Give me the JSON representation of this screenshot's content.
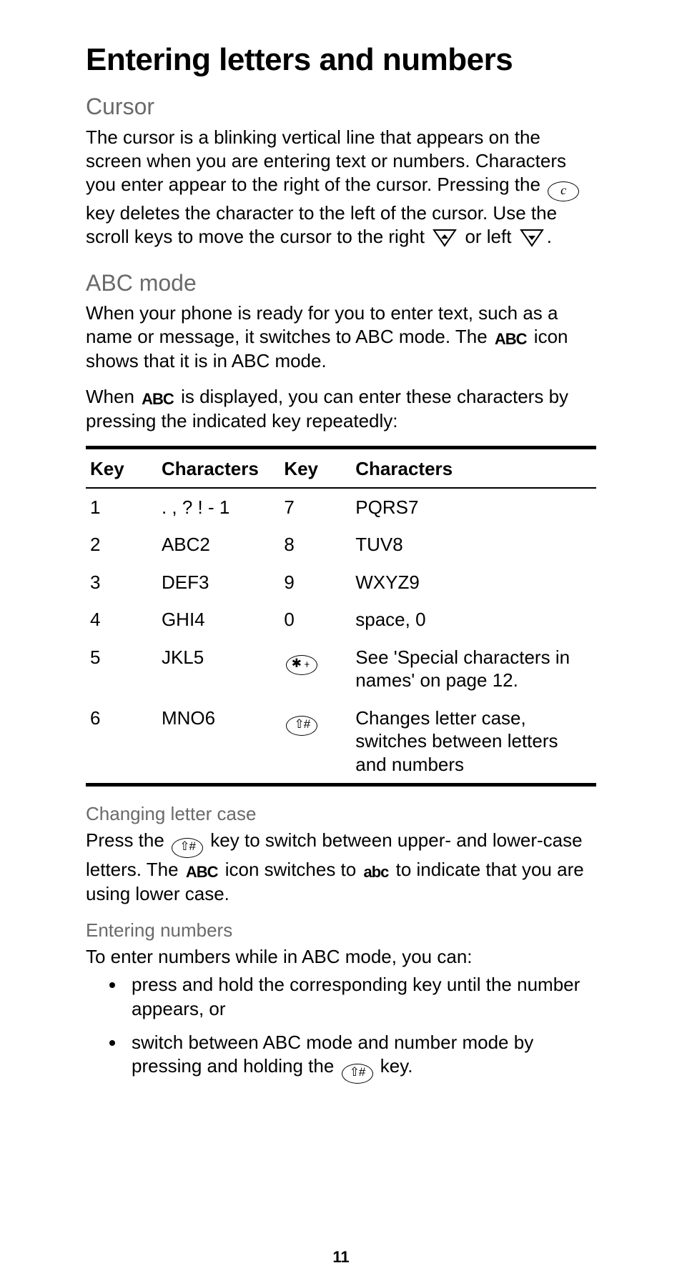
{
  "page_number": "11",
  "title": "Entering letters and numbers",
  "sections": {
    "cursor": {
      "heading": "Cursor",
      "p1a": "The cursor is a blinking vertical line that appears on the screen when you are entering text or numbers. Characters you enter appear to the right of the cursor. Pressing the ",
      "p1b": " key deletes the character to the left of the cursor. Use the scroll keys to move the cursor to the right ",
      "p1c": " or left ",
      "p1d": "."
    },
    "abc": {
      "heading": "ABC mode",
      "p1a": "When your phone is ready for you to enter text, such as a name or message, it switches to ABC mode. The ",
      "p1b": " icon shows that it is in ABC mode.",
      "p2a": "When ",
      "p2b": " is displayed, you can enter these characters by pressing the indicated key repeatedly:"
    },
    "changing_case": {
      "heading": "Changing letter case",
      "p1a": "Press the ",
      "p1b": " key to switch between upper- and lower-case letters. The ",
      "p1c": " icon switches to ",
      "p1d": " to indicate that you are using lower case."
    },
    "entering_numbers": {
      "heading": "Entering numbers",
      "p1": "To enter numbers while in ABC mode, you can:",
      "bullets": [
        "press and hold the corresponding key until the number appears, or",
        "switch between ABC mode and number mode by pressing and holding the "
      ],
      "b2_suffix": " key."
    }
  },
  "table": {
    "headers": [
      "Key",
      "Characters",
      "Key",
      "Characters"
    ],
    "rows": [
      {
        "k1": "1",
        "c1": ". , ? ! - 1",
        "k2": "7",
        "c2": "PQRS7"
      },
      {
        "k1": "2",
        "c1": "ABC2",
        "k2": "8",
        "c2": "TUV8"
      },
      {
        "k1": "3",
        "c1": "DEF3",
        "k2": "9",
        "c2": "WXYZ9"
      },
      {
        "k1": "4",
        "c1": "GHI4",
        "k2": "0",
        "c2": "space, 0"
      },
      {
        "k1": "5",
        "c1": "JKL5",
        "k2_icon": "star",
        "c2": "See 'Special characters in names' on page 12."
      },
      {
        "k1": "6",
        "c1": "MNO6",
        "k2_icon": "hash",
        "c2": "Changes letter case, switches between letters and numbers"
      }
    ]
  },
  "icons": {
    "c_key": "c",
    "right_arrow": "▿",
    "left_arrow": "▿",
    "star_key": "✱﹢",
    "hash_key": "⇧#",
    "abc_upper": "ABC",
    "abc_lower": "abc"
  }
}
